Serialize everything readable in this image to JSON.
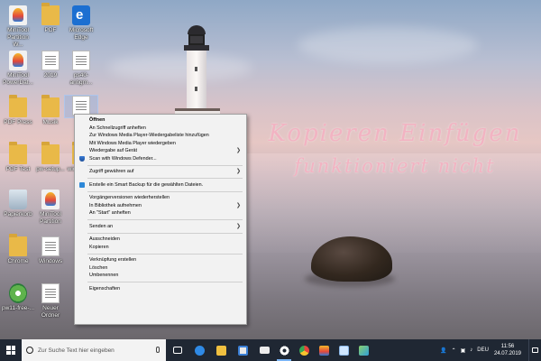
{
  "desktop": {
    "overlay_line1": "Kopieren Einfügen",
    "overlay_line2": "funktioniert nicht",
    "icons": [
      {
        "label": "MiniTool Partition W..."
      },
      {
        "label": "PDF"
      },
      {
        "label": "Microsoft Edge"
      },
      {
        "label": "MiniTool PowerDat..."
      },
      {
        "label": "2019"
      },
      {
        "label": "ps40-antigm..."
      },
      {
        "label": "PDF Press"
      },
      {
        "label": "Musik"
      },
      {
        "label": "PDF Test"
      },
      {
        "label": "pw-setup..."
      },
      {
        "label": "wichtiger..."
      },
      {
        "label": "Papierkorb"
      },
      {
        "label": "MiniTool Partition"
      },
      {
        "label": "Chrome"
      },
      {
        "label": "Windows"
      },
      {
        "label": "pw11-free-..."
      },
      {
        "label": "Neuer Ordner"
      }
    ]
  },
  "context_menu": {
    "items": [
      "Öffnen",
      "An Schnellzugriff anheften",
      "Zur Windows Media Player-Wiedergabeliste hinzufügen",
      "Mit Windows Media Player wiedergeben",
      "Wiedergabe auf Gerät",
      "Scan with Windows Defender...",
      "Zugriff gewähren auf",
      "Erstelle ein Smart Backup für die gewählten Dateien.",
      "Vorgängerversionen wiederherstellen",
      "In Bibliothek aufnehmen",
      "An \"Start\" anheften",
      "Senden an",
      "Ausschneiden",
      "Kopieren",
      "Verknüpfung erstellen",
      "Löschen",
      "Umbenennen",
      "Eigenschaften"
    ]
  },
  "taskbar": {
    "search_placeholder": "Zur Suche Text hier eingeben",
    "language": "DEU",
    "time": "11:56",
    "date": "24.07.2019",
    "pinned_icons": [
      "task-view-icon",
      "edge-icon",
      "file-explorer-icon",
      "store-icon",
      "mail-icon",
      "settings-icon",
      "chrome-icon",
      "minitool-icon",
      "notepad-icon",
      "photos-icon"
    ]
  },
  "colors": {
    "taskbar_bg": "#1f2733",
    "overlay_text": "#f2b3c2",
    "folder": "#e9b948",
    "menu_bg": "#f2f2f2"
  }
}
